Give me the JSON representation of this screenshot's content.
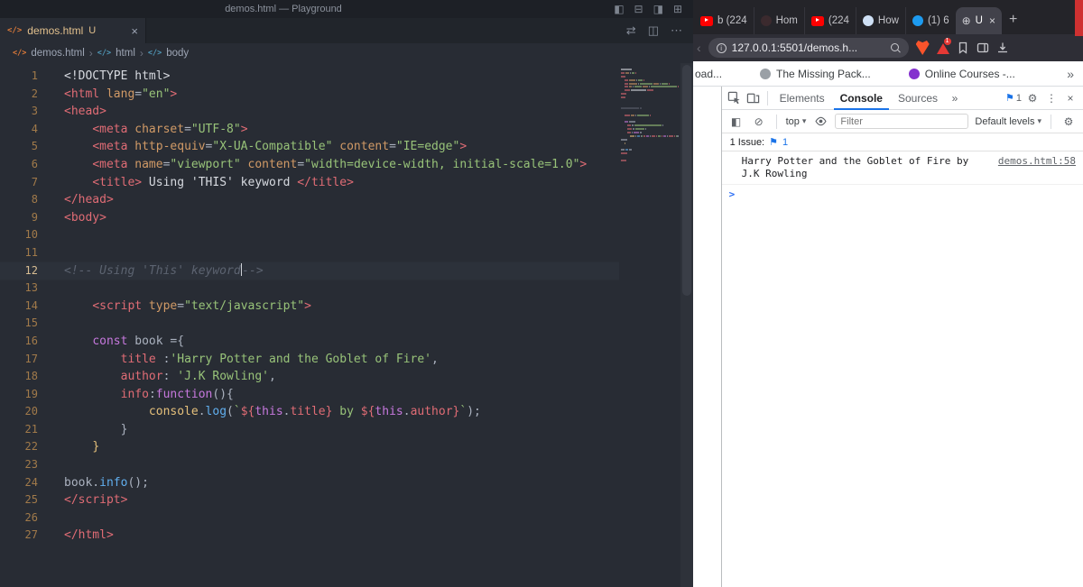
{
  "colors": {
    "vscode_bg": "#282c34",
    "vscode_tag": "#e06c75",
    "vscode_string": "#98c379",
    "vscode_keyword": "#c678dd",
    "brave_orange": "#fb542b",
    "youtube_red": "#ff0000",
    "twitter_blue": "#1d9bf0",
    "devtools_accent": "#1a73e8",
    "red_edge": "#cf3131"
  },
  "icons": {
    "toggle_primary_sidebar": "◧",
    "toggle_panel": "⊟",
    "toggle_secondary_sidebar": "◨",
    "customize_layout": "⊞",
    "compare_changes": "⇄",
    "split_editor": "◫",
    "more_actions": "⋯",
    "tab_close": "×",
    "breadcrumb_separator": "›",
    "html_file": "</>",
    "symbol_tag": "</>",
    "globe": "⊕",
    "new_tab": "+",
    "back": "‹",
    "site_info": "i",
    "overflow": "»",
    "caret_down": "▾",
    "console_sidebar": "◧",
    "clear_console": "⊘",
    "issues_flag": "⚑",
    "settings_gear": "⚙",
    "more_vert": "⋮",
    "close": "×",
    "prompt": ">"
  },
  "vscode": {
    "window_title": "demos.html — Playground",
    "tab": {
      "label": "demos.html",
      "git_status": "U"
    },
    "breadcrumb": {
      "items": [
        {
          "label": "demos.html"
        },
        {
          "label": "html"
        },
        {
          "label": "body"
        }
      ]
    },
    "editor": {
      "cursor_line": 12,
      "lines": [
        [
          [
            "wh",
            "<!DOCTYPE html>"
          ]
        ],
        [
          [
            "tag",
            "<html"
          ],
          [
            "attr",
            " lang"
          ],
          [
            "pl",
            "="
          ],
          [
            "str",
            "\"en\""
          ],
          [
            "tag",
            ">"
          ]
        ],
        [
          [
            "tag",
            "<head>"
          ]
        ],
        [
          [
            "pl",
            "    "
          ],
          [
            "tag",
            "<meta"
          ],
          [
            "attr",
            " charset"
          ],
          [
            "pl",
            "="
          ],
          [
            "str",
            "\"UTF-8\""
          ],
          [
            "tag",
            ">"
          ]
        ],
        [
          [
            "pl",
            "    "
          ],
          [
            "tag",
            "<meta"
          ],
          [
            "attr",
            " http-equiv"
          ],
          [
            "pl",
            "="
          ],
          [
            "str",
            "\"X-UA-Compatible\""
          ],
          [
            "attr",
            " content"
          ],
          [
            "pl",
            "="
          ],
          [
            "str",
            "\"IE=edge\""
          ],
          [
            "tag",
            ">"
          ]
        ],
        [
          [
            "pl",
            "    "
          ],
          [
            "tag",
            "<meta"
          ],
          [
            "attr",
            " name"
          ],
          [
            "pl",
            "="
          ],
          [
            "str",
            "\"viewport\""
          ],
          [
            "attr",
            " content"
          ],
          [
            "pl",
            "="
          ],
          [
            "str",
            "\"width=device-width, initial-scale=1.0\""
          ],
          [
            "tag",
            ">"
          ]
        ],
        [
          [
            "pl",
            "    "
          ],
          [
            "tag",
            "<title>"
          ],
          [
            "wh",
            " Using 'THIS' keyword "
          ],
          [
            "tag",
            "</title>"
          ]
        ],
        [
          [
            "tag",
            "</head>"
          ]
        ],
        [
          [
            "tag",
            "<body>"
          ]
        ],
        [],
        [],
        [
          [
            "cmt",
            "<!-- Using 'This' keyword"
          ],
          [
            "caret",
            ""
          ],
          [
            "cmt",
            "-->"
          ]
        ],
        [],
        [
          [
            "pl",
            "    "
          ],
          [
            "tag",
            "<script"
          ],
          [
            "attr",
            " type"
          ],
          [
            "pl",
            "="
          ],
          [
            "str",
            "\"text/javascript\""
          ],
          [
            "tag",
            ">"
          ]
        ],
        [],
        [
          [
            "pl",
            "    "
          ],
          [
            "kw",
            "const"
          ],
          [
            "pl",
            " book ={"
          ]
        ],
        [
          [
            "pl",
            "        "
          ],
          [
            "prop",
            "title"
          ],
          [
            "pl",
            " :"
          ],
          [
            "str",
            "'Harry Potter and the Goblet of Fire'"
          ],
          [
            "pl",
            ","
          ]
        ],
        [
          [
            "pl",
            "        "
          ],
          [
            "prop",
            "author"
          ],
          [
            "pl",
            ": "
          ],
          [
            "str",
            "'J.K Rowling'"
          ],
          [
            "pl",
            ","
          ]
        ],
        [
          [
            "pl",
            "        "
          ],
          [
            "prop",
            "info"
          ],
          [
            "pl",
            ":"
          ],
          [
            "kw",
            "function"
          ],
          [
            "pl",
            "(){"
          ]
        ],
        [
          [
            "pl",
            "            "
          ],
          [
            "obj",
            "console"
          ],
          [
            "pl",
            "."
          ],
          [
            "fn",
            "log"
          ],
          [
            "pl",
            "("
          ],
          [
            "str",
            "`"
          ],
          [
            "prop",
            "${"
          ],
          [
            "kw",
            "this"
          ],
          [
            "pl",
            "."
          ],
          [
            "prop",
            "title"
          ],
          [
            "prop",
            "}"
          ],
          [
            "str",
            " by "
          ],
          [
            "prop",
            "${"
          ],
          [
            "kw",
            "this"
          ],
          [
            "pl",
            "."
          ],
          [
            "prop",
            "author"
          ],
          [
            "prop",
            "}"
          ],
          [
            "str",
            "`"
          ],
          [
            "pl",
            ");"
          ]
        ],
        [
          [
            "pl",
            "        }"
          ]
        ],
        [
          [
            "pl",
            "    "
          ],
          [
            "obj",
            "}"
          ]
        ],
        [],
        [
          [
            "pl",
            "book."
          ],
          [
            "fn",
            "info"
          ],
          [
            "pl",
            "();"
          ]
        ],
        [
          [
            "tag",
            "</script>"
          ]
        ],
        [],
        [
          [
            "tag",
            "</html>"
          ]
        ]
      ]
    }
  },
  "browser": {
    "tabs": [
      {
        "label": "b (224",
        "icon": "youtube-icon",
        "active": false
      },
      {
        "label": "Hom",
        "icon": "site-icon-dark",
        "active": false
      },
      {
        "label": "(224",
        "icon": "youtube-icon",
        "active": false
      },
      {
        "label": "How",
        "icon": "site-icon-light",
        "active": false
      },
      {
        "label": "(1) 6",
        "icon": "twitter-icon",
        "active": false
      },
      {
        "label": "U",
        "icon": "globe-icon",
        "active": true
      }
    ],
    "address_bar": {
      "url": "127.0.0.1:5501/demos.h...",
      "extension_badge": "1"
    },
    "bookmarks": {
      "items": [
        {
          "label": "oad...",
          "icon": "none"
        },
        {
          "label": "The Missing Pack...",
          "icon": "site-icon-gray"
        },
        {
          "label": "Online Courses -...",
          "icon": "site-icon-purple"
        }
      ]
    },
    "devtools": {
      "panel_tabs": [
        "Elements",
        "Console",
        "Sources"
      ],
      "active_panel": "Console",
      "header_issue_count": "1",
      "context_selector": "top",
      "filter_placeholder": "Filter",
      "log_level_selector": "Default levels",
      "issues_bar": {
        "label": "1 Issue:",
        "count": "1"
      },
      "console_messages": [
        {
          "text": "Harry Potter and the Goblet of Fire by J.K Rowling",
          "source_link": "demos.html:58"
        }
      ]
    }
  }
}
